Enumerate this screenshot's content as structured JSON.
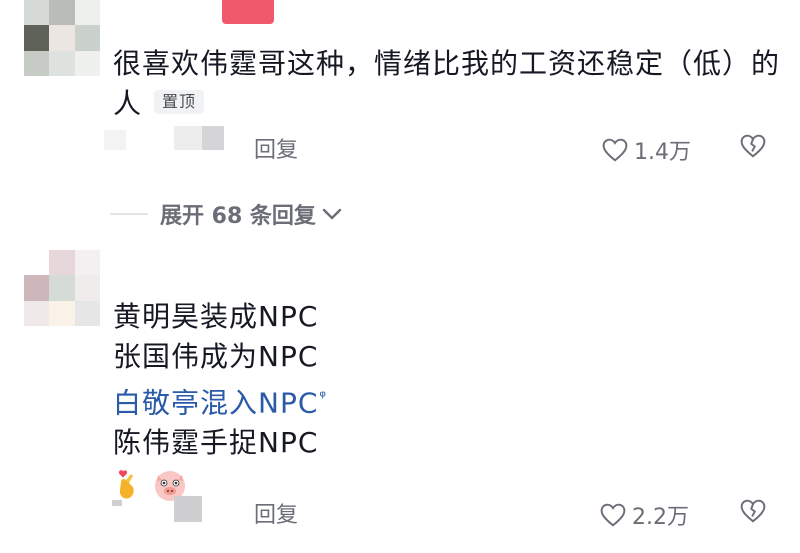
{
  "comments": [
    {
      "text_line1": "很喜欢伟霆哥这种，情绪比我的工资还稳定（低）的",
      "text_line2": "人",
      "pin_label": "置顶",
      "reply_label": "回复",
      "like_count": "1.4万"
    },
    {
      "lines": [
        "黄明昊装成NPC",
        "张国伟成为NPC"
      ],
      "link_text": "白敬亭混入NPC",
      "link_search_glyph": "ᵠ",
      "last_line": "陈伟霆手捉NPC",
      "emojis": [
        "finger-heart-emoji",
        "pig-face-emoji"
      ],
      "reply_label": "回复",
      "like_count": "2.2万"
    }
  ],
  "expand_replies": {
    "label": "展开 68 条回复",
    "icon": "chevron-down-icon"
  },
  "colors": {
    "link": "#2a5aa8",
    "meta": "#6b6e77",
    "text": "#161823"
  }
}
